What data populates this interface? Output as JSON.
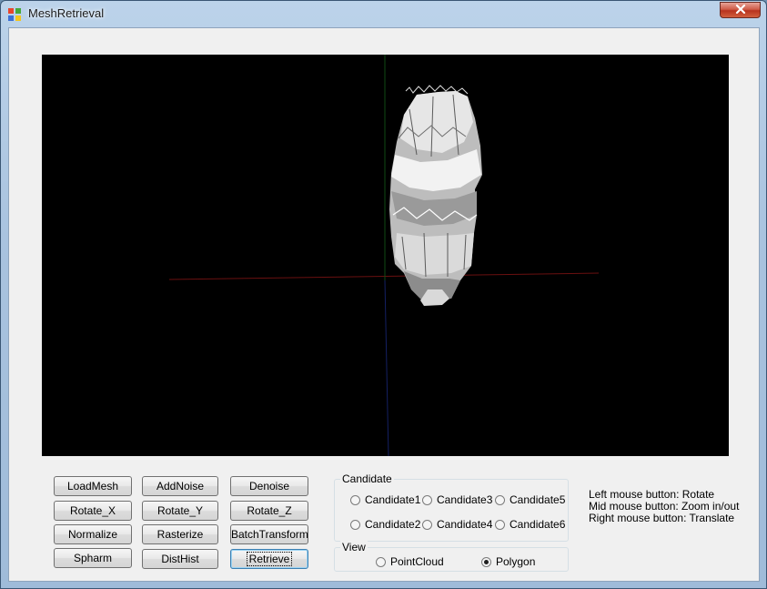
{
  "window": {
    "title": "MeshRetrieval",
    "icon": "app-icon",
    "close_icon": "x-icon"
  },
  "viewport": {
    "background": "#000000",
    "axes_colors": {
      "x": "#7a1010",
      "y": "#104a10",
      "z": "#101a6a"
    }
  },
  "buttons": {
    "load_mesh": "LoadMesh",
    "add_noise": "AddNoise",
    "denoise": "Denoise",
    "rotate_x": "Rotate_X",
    "rotate_y": "Rotate_Y",
    "rotate_z": "Rotate_Z",
    "normalize": "Normalize",
    "rasterize": "Rasterize",
    "batch_transform": "BatchTransform",
    "spharm": "Spharm",
    "dist_hist": "DistHist",
    "retrieve": "Retrieve"
  },
  "candidate_group": {
    "label": "Candidate",
    "options": [
      "Candidate1",
      "Candidate3",
      "Candidate5",
      "Candidate2",
      "Candidate4",
      "Candidate6"
    ]
  },
  "view_group": {
    "label": "View",
    "options": [
      "PointCloud",
      "Polygon"
    ],
    "selected": "Polygon"
  },
  "help": {
    "left": "Left mouse button: Rotate",
    "mid": "Mid mouse button: Zoom in/out",
    "right": "Right mouse button: Translate"
  }
}
